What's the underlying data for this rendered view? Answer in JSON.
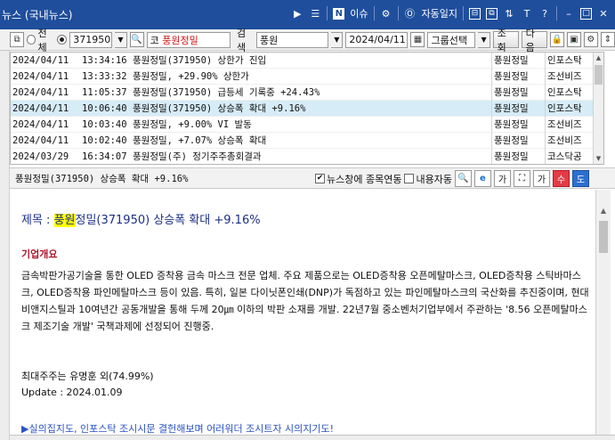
{
  "window": {
    "title": "뉴스 (국내뉴스)"
  },
  "titlebar": {
    "icons": [
      "play-icon",
      "menu-icon"
    ],
    "news_issue_label": "이슈",
    "auto_log_label": "자동일지",
    "right_icons": [
      "split-icon",
      "copy-icon",
      "sort-icon",
      "text-size-icon",
      "help-icon",
      "minimize-icon",
      "restore-icon",
      "close-icon"
    ]
  },
  "toolbar": {
    "radio_all_label": "전체",
    "stock_code": "371950",
    "code_prefix": "코",
    "stock_name": "풍원정밀",
    "search_label": "검색",
    "search_value": "풍원",
    "date_value": "2024/04/11",
    "group_select": "그룹선택",
    "query_button": "조회",
    "next_button": "다음"
  },
  "news": {
    "rows": [
      {
        "date": "2024/04/11",
        "time": "13:34:16",
        "title": "풍원정밀(371950)  상한가 진입",
        "name": "풍원정밀",
        "source": "인포스탁"
      },
      {
        "date": "2024/04/11",
        "time": "13:33:32",
        "title": "풍원정밀, +29.90% 상한가",
        "name": "풍원정밀",
        "source": "조선비즈"
      },
      {
        "date": "2024/04/11",
        "time": "11:05:37",
        "title": "풍원정밀(371950) 급등세 기록중 +24.43%",
        "name": "풍원정밀",
        "source": "인포스탁"
      },
      {
        "date": "2024/04/11",
        "time": "10:06:40",
        "title": "풍원정밀(371950) 상승폭 확대 +9.16%",
        "name": "풍원정밀",
        "source": "인포스탁"
      },
      {
        "date": "2024/04/11",
        "time": "10:03:40",
        "title": "풍원정밀, +9.00% VI 발동",
        "name": "풍원정밀",
        "source": "조선비즈"
      },
      {
        "date": "2024/04/11",
        "time": "10:02:40",
        "title": "풍원정밀, +7.07% 상승폭 확대",
        "name": "풍원정밀",
        "source": "조선비즈"
      },
      {
        "date": "2024/03/29",
        "time": "16:34:07",
        "title": "풍원정밀(주) 정기주주총회결과",
        "name": "풍원정밀",
        "source": "코스닥공"
      }
    ],
    "selected_index": 3
  },
  "detail": {
    "title": "풍원정밀(371950) 상승폭 확대 +9.16%",
    "link_news_label": "뉴스창에 종목연동",
    "content_auto_label": "내용자동"
  },
  "article": {
    "headline_prefix": "제목 : ",
    "headline_highlight": "풍원",
    "headline_rest": "정밀(371950) 상승폭 확대 +9.16%",
    "section_title": "기업개요",
    "body": "금속박판가공기술을 통한 OLED 증착용 금속 마스크 전문 업체. 주요 제품으로는 OLED증착용 오픈메탈마스크, OLED증착용 스틱바마스크, OLED증착용 파인메탈마스크 등이 있음. 특히, 일본 다이닛폰인쇄(DNP)가 독점하고 있는 파인메탈마스크의 국산화를 추진중이며, 현대비앤지스틸과 10여년간 공동개발을 통해 두께 20㎛ 이하의 박판 소재를 개발. 22년7월 중소벤처기업부에서 주관하는 '8.56 오픈메탈마스크 제조기술 개발' 국책과제에 선정되어 진행중.",
    "holder": "최대주주는 유명훈 외(74.99%)",
    "update": "Update : 2024.01.09",
    "link_text": "▶실의집지도, 인포스탁 조시시문 결헌해보며 어러워더 조시트자 시의지기도!"
  }
}
